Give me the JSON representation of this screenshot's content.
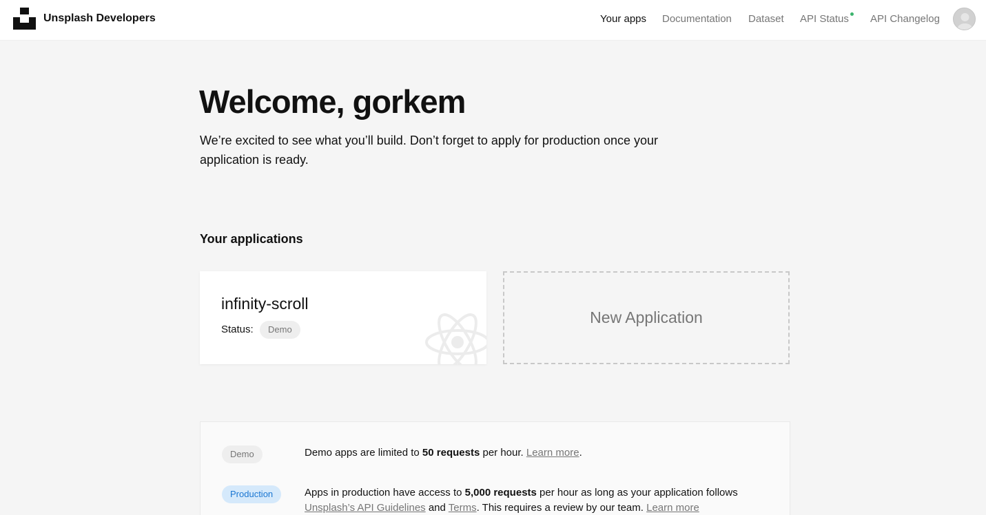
{
  "header": {
    "brand": "Unsplash Developers",
    "nav": {
      "your_apps": "Your apps",
      "documentation": "Documentation",
      "dataset": "Dataset",
      "api_status": "API Status",
      "api_changelog": "API Changelog"
    },
    "status_dot_color": "#3cb46e"
  },
  "hero": {
    "title": "Welcome, gorkem",
    "intro": "We’re excited to see what you’ll build. Don’t forget to apply for production once your application is ready."
  },
  "applications": {
    "heading": "Your applications",
    "items": [
      {
        "name": "infinity-scroll",
        "status_label": "Status:",
        "status": "Demo",
        "icon": "react-atom-icon"
      }
    ],
    "new_app_label": "New Application"
  },
  "tiers": {
    "demo": {
      "badge": "Demo",
      "text_before": "Demo apps are limited to ",
      "bold": "50 requests",
      "text_after": " per hour. ",
      "link": "Learn more",
      "end": "."
    },
    "production": {
      "badge": "Production",
      "text_before": "Apps in production have access to ",
      "bold": "5,000 requests",
      "text_after": " per hour as long as your application follows",
      "link_guidelines": "Unsplash’s API Guidelines",
      "and": " and ",
      "link_terms": "Terms",
      "review": ". This requires a review by our team. ",
      "link_more": "Learn more"
    }
  },
  "colors": {
    "page_bg": "#f5f5f5",
    "demo_badge_bg": "#eeeeee",
    "production_badge_bg": "#d5e9fb",
    "production_badge_text": "#1a76d2"
  }
}
